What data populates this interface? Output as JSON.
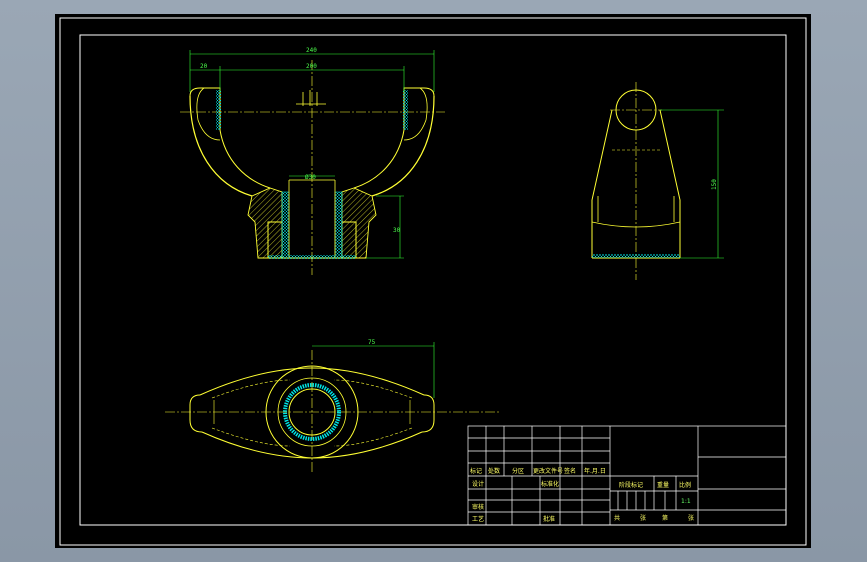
{
  "colors": {
    "background": "#8d9aa8",
    "sheet": "#000000",
    "outline": "#ffff33",
    "center": "#ffff33",
    "hidden": "#ffff33",
    "dimension": "#33ff33",
    "hatch": "#ffff33",
    "frame": "#ffffff",
    "section": "#00e5e5"
  },
  "dimensions": {
    "overall_width": "240",
    "inner_width": "200",
    "wall": "20",
    "bore": "Ø30",
    "hub_height": "30",
    "side_height": "150",
    "plan_length": "75"
  },
  "title_block": {
    "rev_headers": [
      "标记",
      "处数",
      "分区",
      "更改文件号",
      "签名",
      "年.月.日"
    ],
    "design": "设计",
    "standardize": "标准化",
    "review": "审核",
    "process": "工艺",
    "approve": "批准",
    "stage_mark": "阶段标记",
    "weight": "重量",
    "scale": "比例",
    "scale_value": "1:1",
    "sheets_total": "共",
    "sheets_unit": "张",
    "sheet_no": "第",
    "sheet_unit": "张"
  }
}
